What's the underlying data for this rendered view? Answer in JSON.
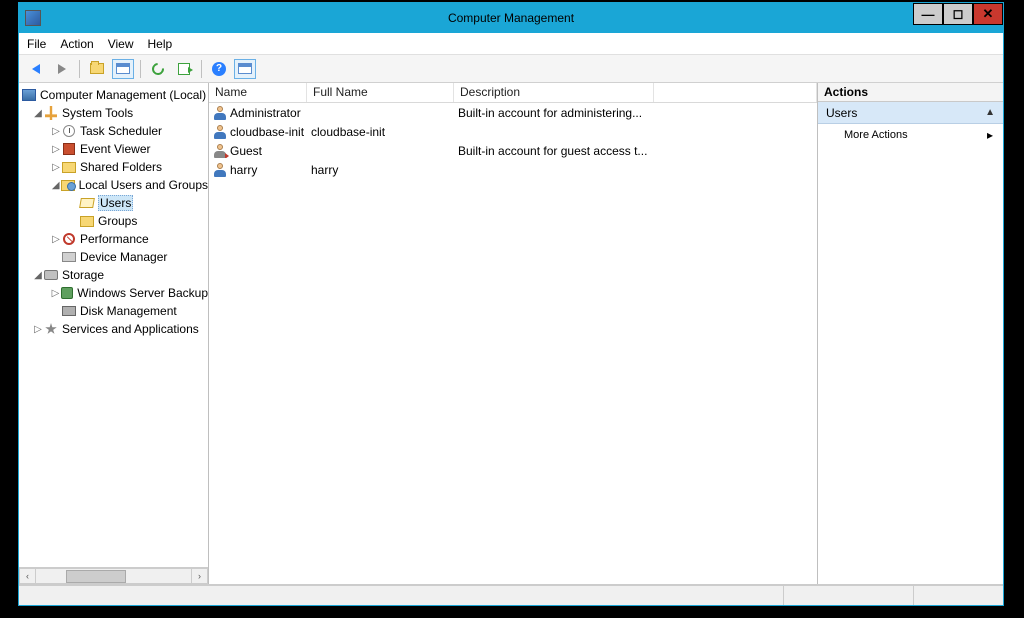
{
  "window": {
    "title": "Computer Management"
  },
  "menu": {
    "file": "File",
    "action": "Action",
    "view": "View",
    "help": "Help"
  },
  "tree": {
    "root": "Computer Management (Local)",
    "system_tools": "System Tools",
    "task_scheduler": "Task Scheduler",
    "event_viewer": "Event Viewer",
    "shared_folders": "Shared Folders",
    "local_users_groups": "Local Users and Groups",
    "users": "Users",
    "groups": "Groups",
    "performance": "Performance",
    "device_manager": "Device Manager",
    "storage": "Storage",
    "windows_server_backup": "Windows Server Backup",
    "disk_management": "Disk Management",
    "services_apps": "Services and Applications"
  },
  "list": {
    "columns": {
      "name": "Name",
      "full_name": "Full Name",
      "description": "Description"
    },
    "rows": [
      {
        "name": "Administrator",
        "full_name": "",
        "description": "Built-in account for administering...",
        "disabled": false
      },
      {
        "name": "cloudbase-init",
        "full_name": "cloudbase-init",
        "description": "",
        "disabled": false
      },
      {
        "name": "Guest",
        "full_name": "",
        "description": "Built-in account for guest access t...",
        "disabled": true
      },
      {
        "name": "harry",
        "full_name": "harry",
        "description": "",
        "disabled": false
      }
    ]
  },
  "actions": {
    "title": "Actions",
    "group": "Users",
    "more": "More Actions"
  }
}
